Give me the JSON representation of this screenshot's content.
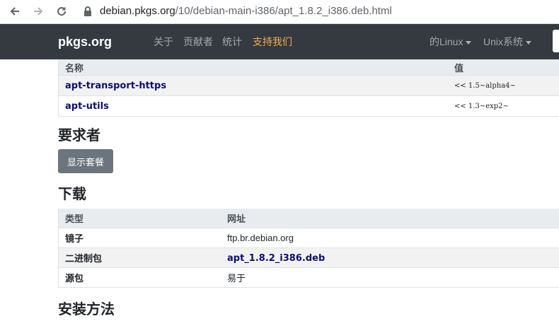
{
  "browser": {
    "url_host": "debian.pkgs.org",
    "url_path": "/10/debian-main-i386/apt_1.8.2_i386.deb.html"
  },
  "navbar": {
    "brand": "pkgs.org",
    "links": [
      "关于",
      "贡献者",
      "统计",
      "支持我们"
    ],
    "right_menus": [
      "的Linux",
      "Unix系统"
    ]
  },
  "provides_table": {
    "headers": [
      "名称",
      "值"
    ],
    "rows": [
      {
        "name": "apt-transport-https",
        "value": "<< 1.5~alpha4~"
      },
      {
        "name": "apt-utils",
        "value": "<< 1.3~exp2~"
      }
    ]
  },
  "required_by": {
    "title": "要求者",
    "button": "显示套餐"
  },
  "download": {
    "title": "下载",
    "headers": [
      "类型",
      "网址"
    ],
    "rows": [
      {
        "type": "镜子",
        "url": "ftp.br.debian.org"
      },
      {
        "type": "二进制包",
        "url": "apt_1.8.2_i386.deb"
      },
      {
        "type": "源包",
        "url": "易于"
      }
    ]
  },
  "install": {
    "title": "安装方法"
  },
  "colors": {
    "navbar_bg": "#343a40",
    "support_link": "#f0ad4e",
    "package_link": "#0d0d73",
    "button_bg": "#6c757d"
  }
}
